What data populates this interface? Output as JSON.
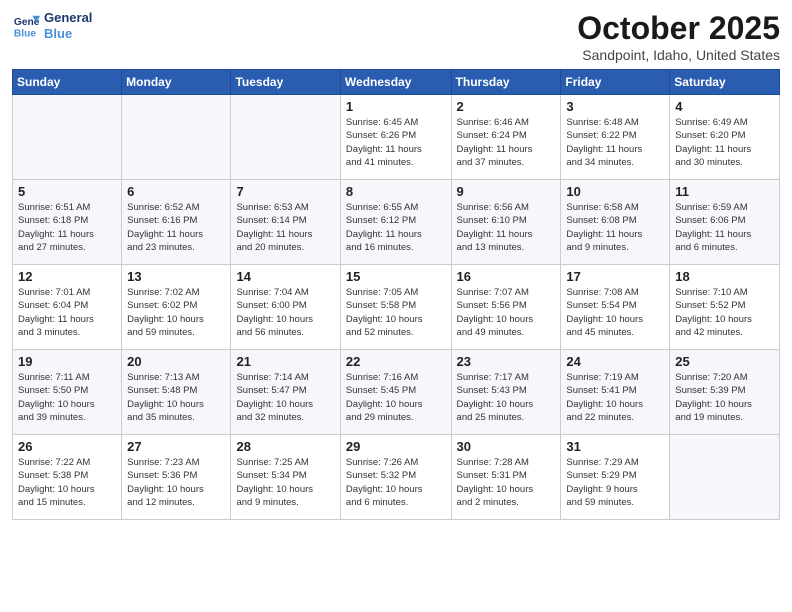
{
  "header": {
    "logo_line1": "General",
    "logo_line2": "Blue",
    "month_title": "October 2025",
    "location": "Sandpoint, Idaho, United States"
  },
  "weekdays": [
    "Sunday",
    "Monday",
    "Tuesday",
    "Wednesday",
    "Thursday",
    "Friday",
    "Saturday"
  ],
  "weeks": [
    [
      {
        "day": "",
        "info": ""
      },
      {
        "day": "",
        "info": ""
      },
      {
        "day": "",
        "info": ""
      },
      {
        "day": "1",
        "info": "Sunrise: 6:45 AM\nSunset: 6:26 PM\nDaylight: 11 hours\nand 41 minutes."
      },
      {
        "day": "2",
        "info": "Sunrise: 6:46 AM\nSunset: 6:24 PM\nDaylight: 11 hours\nand 37 minutes."
      },
      {
        "day": "3",
        "info": "Sunrise: 6:48 AM\nSunset: 6:22 PM\nDaylight: 11 hours\nand 34 minutes."
      },
      {
        "day": "4",
        "info": "Sunrise: 6:49 AM\nSunset: 6:20 PM\nDaylight: 11 hours\nand 30 minutes."
      }
    ],
    [
      {
        "day": "5",
        "info": "Sunrise: 6:51 AM\nSunset: 6:18 PM\nDaylight: 11 hours\nand 27 minutes."
      },
      {
        "day": "6",
        "info": "Sunrise: 6:52 AM\nSunset: 6:16 PM\nDaylight: 11 hours\nand 23 minutes."
      },
      {
        "day": "7",
        "info": "Sunrise: 6:53 AM\nSunset: 6:14 PM\nDaylight: 11 hours\nand 20 minutes."
      },
      {
        "day": "8",
        "info": "Sunrise: 6:55 AM\nSunset: 6:12 PM\nDaylight: 11 hours\nand 16 minutes."
      },
      {
        "day": "9",
        "info": "Sunrise: 6:56 AM\nSunset: 6:10 PM\nDaylight: 11 hours\nand 13 minutes."
      },
      {
        "day": "10",
        "info": "Sunrise: 6:58 AM\nSunset: 6:08 PM\nDaylight: 11 hours\nand 9 minutes."
      },
      {
        "day": "11",
        "info": "Sunrise: 6:59 AM\nSunset: 6:06 PM\nDaylight: 11 hours\nand 6 minutes."
      }
    ],
    [
      {
        "day": "12",
        "info": "Sunrise: 7:01 AM\nSunset: 6:04 PM\nDaylight: 11 hours\nand 3 minutes."
      },
      {
        "day": "13",
        "info": "Sunrise: 7:02 AM\nSunset: 6:02 PM\nDaylight: 10 hours\nand 59 minutes."
      },
      {
        "day": "14",
        "info": "Sunrise: 7:04 AM\nSunset: 6:00 PM\nDaylight: 10 hours\nand 56 minutes."
      },
      {
        "day": "15",
        "info": "Sunrise: 7:05 AM\nSunset: 5:58 PM\nDaylight: 10 hours\nand 52 minutes."
      },
      {
        "day": "16",
        "info": "Sunrise: 7:07 AM\nSunset: 5:56 PM\nDaylight: 10 hours\nand 49 minutes."
      },
      {
        "day": "17",
        "info": "Sunrise: 7:08 AM\nSunset: 5:54 PM\nDaylight: 10 hours\nand 45 minutes."
      },
      {
        "day": "18",
        "info": "Sunrise: 7:10 AM\nSunset: 5:52 PM\nDaylight: 10 hours\nand 42 minutes."
      }
    ],
    [
      {
        "day": "19",
        "info": "Sunrise: 7:11 AM\nSunset: 5:50 PM\nDaylight: 10 hours\nand 39 minutes."
      },
      {
        "day": "20",
        "info": "Sunrise: 7:13 AM\nSunset: 5:48 PM\nDaylight: 10 hours\nand 35 minutes."
      },
      {
        "day": "21",
        "info": "Sunrise: 7:14 AM\nSunset: 5:47 PM\nDaylight: 10 hours\nand 32 minutes."
      },
      {
        "day": "22",
        "info": "Sunrise: 7:16 AM\nSunset: 5:45 PM\nDaylight: 10 hours\nand 29 minutes."
      },
      {
        "day": "23",
        "info": "Sunrise: 7:17 AM\nSunset: 5:43 PM\nDaylight: 10 hours\nand 25 minutes."
      },
      {
        "day": "24",
        "info": "Sunrise: 7:19 AM\nSunset: 5:41 PM\nDaylight: 10 hours\nand 22 minutes."
      },
      {
        "day": "25",
        "info": "Sunrise: 7:20 AM\nSunset: 5:39 PM\nDaylight: 10 hours\nand 19 minutes."
      }
    ],
    [
      {
        "day": "26",
        "info": "Sunrise: 7:22 AM\nSunset: 5:38 PM\nDaylight: 10 hours\nand 15 minutes."
      },
      {
        "day": "27",
        "info": "Sunrise: 7:23 AM\nSunset: 5:36 PM\nDaylight: 10 hours\nand 12 minutes."
      },
      {
        "day": "28",
        "info": "Sunrise: 7:25 AM\nSunset: 5:34 PM\nDaylight: 10 hours\nand 9 minutes."
      },
      {
        "day": "29",
        "info": "Sunrise: 7:26 AM\nSunset: 5:32 PM\nDaylight: 10 hours\nand 6 minutes."
      },
      {
        "day": "30",
        "info": "Sunrise: 7:28 AM\nSunset: 5:31 PM\nDaylight: 10 hours\nand 2 minutes."
      },
      {
        "day": "31",
        "info": "Sunrise: 7:29 AM\nSunset: 5:29 PM\nDaylight: 9 hours\nand 59 minutes."
      },
      {
        "day": "",
        "info": ""
      }
    ]
  ]
}
